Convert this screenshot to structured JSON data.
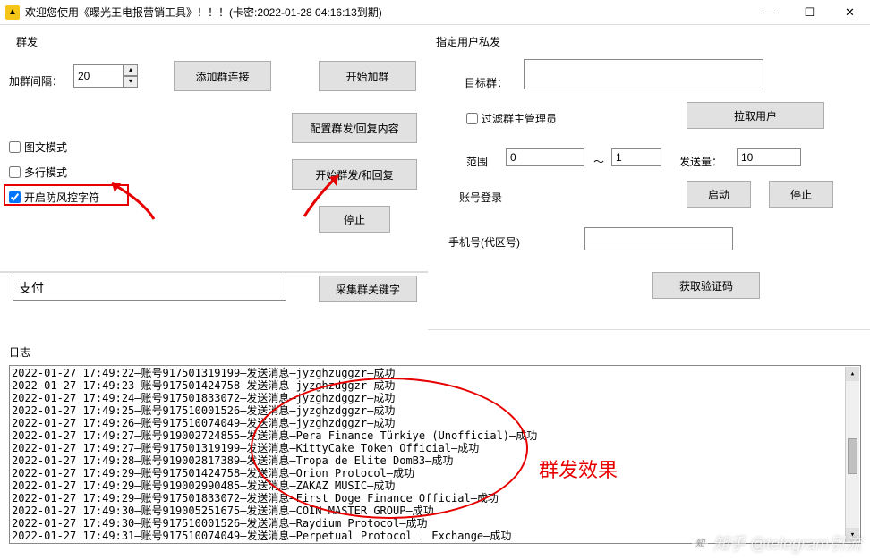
{
  "title": "欢迎您使用《曝光王电报营销工具》！！！(卡密:2022-01-28 04:16:13到期)",
  "left": {
    "group_title": "群发",
    "interval_label": "加群间隔：",
    "interval_value": "20",
    "btn_add_link": "添加群连接",
    "btn_start_join": "开始加群",
    "btn_config": "配置群发/回复内容",
    "chk_image_mode": "图文模式",
    "chk_multiline": "多行模式",
    "chk_antiwind": "开启防风控字符",
    "btn_start_send": "开始群发/和回复",
    "btn_stop": "停止",
    "keyword_value": "支付",
    "btn_collect_kw": "采集群关键字"
  },
  "right": {
    "group_title": "指定用户私发",
    "target_label": "目标群：",
    "chk_filter_admin": "过滤群主管理员",
    "btn_pull_users": "拉取用户",
    "range_label": "范围",
    "range_from": "0",
    "range_sep": "～",
    "range_to": "1",
    "send_qty_label": "发送量：",
    "send_qty_value": "10",
    "acct_login_label": "账号登录",
    "btn_start": "启动",
    "btn_stop2": "停止",
    "phone_label": "手机号(代区号)",
    "btn_get_code": "获取验证码"
  },
  "log_label": "日志",
  "log_lines": [
    "2022-01-27 17:49:22—账号917501319199—发送消息—jyzghzuggzr—成功",
    "2022-01-27 17:49:23—账号917501424758—发送消息—jyzghzdggzr—成功",
    "2022-01-27 17:49:24—账号917501833072—发送消息—jyzghzdggzr—成功",
    "2022-01-27 17:49:25—账号917510001526—发送消息—jyzghzdggzr—成功",
    "2022-01-27 17:49:26—账号917510074049—发送消息—jyzghzdggzr—成功",
    "2022-01-27 17:49:27—账号919002724855—发送消息—Pera Finance Türkiye (Unofficial)—成功",
    "2022-01-27 17:49:27—账号917501319199—发送消息—KittyCake Token Official—成功",
    "2022-01-27 17:49:28—账号919002817389—发送消息—Tropa de Elite DomB3—成功",
    "2022-01-27 17:49:29—账号917501424758—发送消息—Orion Protocol—成功",
    "2022-01-27 17:49:29—账号919002990485—发送消息—ZAKAZ MUSIC—成功",
    "2022-01-27 17:49:29—账号917501833072—发送消息—First Doge Finance Official—成功",
    "2022-01-27 17:49:30—账号919005251675—发送消息—COIN MASTER GROUP—成功",
    "2022-01-27 17:49:30—账号917510001526—发送消息—Raydium Protocol—成功",
    "2022-01-27 17:49:31—账号917510074049—发送消息—Perpetual Protocol | Exchange—成功"
  ],
  "oval_text": "群发效果",
  "watermark": "知乎 @telegram引流"
}
